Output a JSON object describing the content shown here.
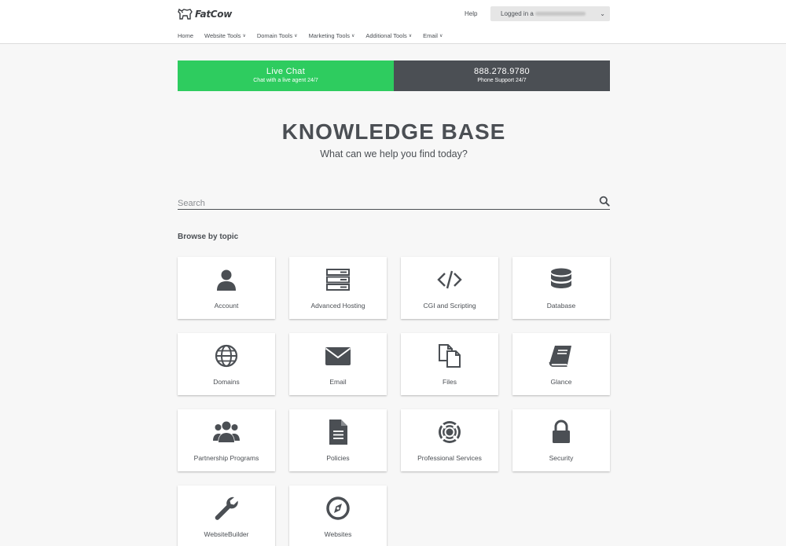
{
  "header": {
    "logo_text": "FatCow",
    "help": "Help",
    "account_prefix": "Logged in a",
    "account_caret": "⌄"
  },
  "nav": [
    {
      "label": "Home",
      "dropdown": false
    },
    {
      "label": "Website Tools",
      "dropdown": true
    },
    {
      "label": "Domain Tools",
      "dropdown": true
    },
    {
      "label": "Marketing Tools",
      "dropdown": true
    },
    {
      "label": "Additional Tools",
      "dropdown": true
    },
    {
      "label": "Email",
      "dropdown": true
    }
  ],
  "contact": {
    "chat_title": "Live Chat",
    "chat_sub": "Chat with a live agent 24/7",
    "phone_title": "888.278.9780",
    "phone_sub": "Phone Support 24/7"
  },
  "hero": {
    "title": "KNOWLEDGE BASE",
    "subtitle": "What can we help you find today?"
  },
  "search": {
    "placeholder": "Search",
    "value": ""
  },
  "browse_label": "Browse by topic",
  "topics": [
    {
      "label": "Account",
      "icon": "user-icon"
    },
    {
      "label": "Advanced Hosting",
      "icon": "server-icon"
    },
    {
      "label": "CGI and Scripting",
      "icon": "code-icon"
    },
    {
      "label": "Database",
      "icon": "database-icon"
    },
    {
      "label": "Domains",
      "icon": "globe-icon"
    },
    {
      "label": "Email",
      "icon": "envelope-icon"
    },
    {
      "label": "Files",
      "icon": "files-icon"
    },
    {
      "label": "Glance",
      "icon": "book-icon"
    },
    {
      "label": "Partnership Programs",
      "icon": "users-icon"
    },
    {
      "label": "Policies",
      "icon": "document-icon"
    },
    {
      "label": "Professional Services",
      "icon": "lifebuoy-icon"
    },
    {
      "label": "Security",
      "icon": "lock-icon"
    },
    {
      "label": "WebsiteBuilder",
      "icon": "wrench-icon"
    },
    {
      "label": "Websites",
      "icon": "compass-icon"
    }
  ],
  "colors": {
    "chat_green": "#2ecc5f",
    "dark_gray": "#4b4f54",
    "page_bg": "#f7f7f7"
  }
}
